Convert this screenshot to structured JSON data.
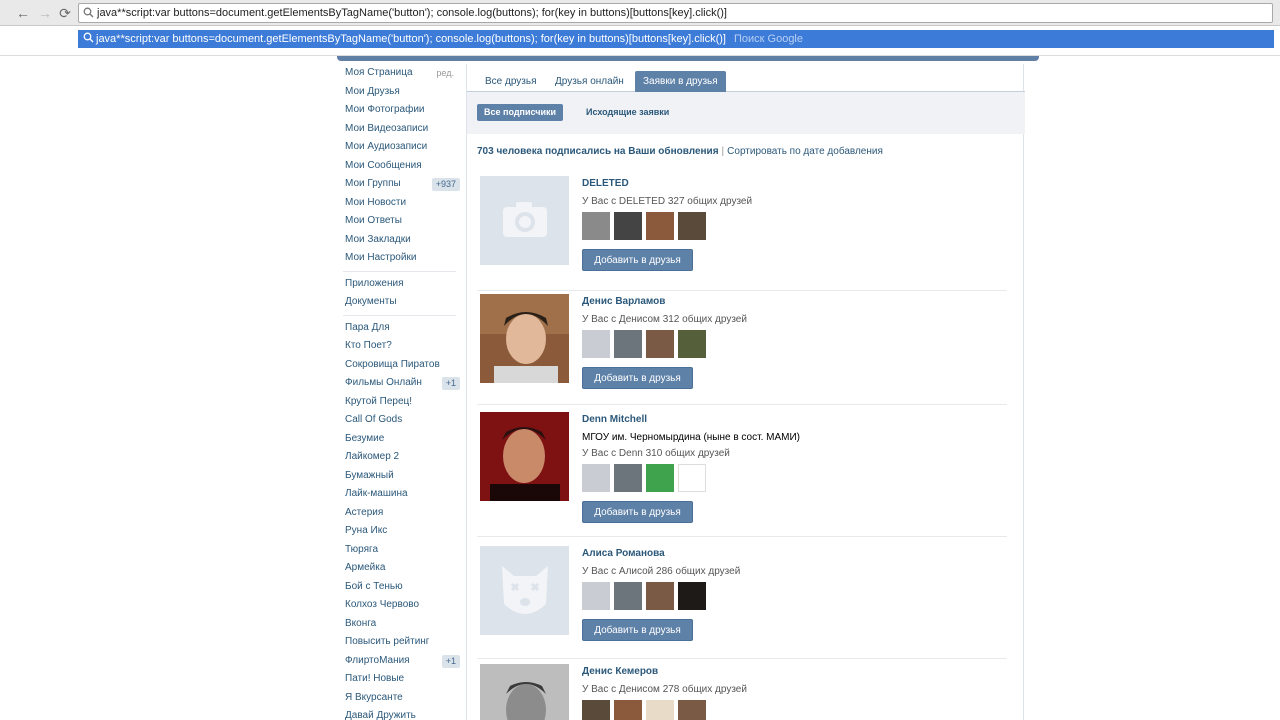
{
  "browser": {
    "address_text": "java**script:var buttons=document.getElementsByTagName('button'); console.log(buttons); for(key in buttons)[buttons[key].click()]",
    "suggestion_text": "java**script:var buttons=document.getElementsByTagName('button'); console.log(buttons); for(key in buttons)[buttons[key].click()]",
    "suggestion_hint": "Поиск Google",
    "icons": {
      "back": "←",
      "forward": "→",
      "reload": "⟳",
      "search": "🔍"
    }
  },
  "sidebar": {
    "edit_label": "ред.",
    "items": [
      {
        "label": "Моя Страница"
      },
      {
        "label": "Мои Друзья"
      },
      {
        "label": "Мои Фотографии"
      },
      {
        "label": "Мои Видеозаписи"
      },
      {
        "label": "Мои Аудиозаписи"
      },
      {
        "label": "Мои Сообщения"
      },
      {
        "label": "Мои Группы",
        "badge": "+937"
      },
      {
        "label": "Мои Новости"
      },
      {
        "label": "Мои Ответы"
      },
      {
        "label": "Мои Закладки"
      },
      {
        "label": "Мои Настройки"
      }
    ],
    "apps_section": [
      {
        "label": "Приложения"
      },
      {
        "label": "Документы"
      }
    ],
    "games": [
      {
        "label": "Пара Для"
      },
      {
        "label": "Кто Поет?"
      },
      {
        "label": "Сокровища Пиратов"
      },
      {
        "label": "Фильмы Онлайн",
        "badge": "+1"
      },
      {
        "label": "Крутой Перец!"
      },
      {
        "label": "Call Of Gods"
      },
      {
        "label": "Безумие"
      },
      {
        "label": "Лайкомер 2"
      },
      {
        "label": "Бумажный"
      },
      {
        "label": "Лайк-машина"
      },
      {
        "label": "Астерия"
      },
      {
        "label": "Руна Икс"
      },
      {
        "label": "Тюряга"
      },
      {
        "label": "Армейка"
      },
      {
        "label": "Бой с Тенью"
      },
      {
        "label": "Колхоз Червово"
      },
      {
        "label": "Вконга"
      },
      {
        "label": "Повысить рейтинг"
      },
      {
        "label": "ФлиртоМания",
        "badge": "+1"
      },
      {
        "label": "Пати! Новые"
      },
      {
        "label": "Я Вкурсанте"
      },
      {
        "label": "Давай Дружить"
      }
    ]
  },
  "tabs": [
    {
      "label": "Все друзья"
    },
    {
      "label": "Друзья онлайн"
    },
    {
      "label": "Заявки в друзья",
      "active": true
    }
  ],
  "subtabs": [
    {
      "label": "Все подписчики",
      "active": true
    },
    {
      "label": "Исходящие заявки"
    }
  ],
  "summary": {
    "count_text": "703 человека подписались на Ваши обновления",
    "separator": "|",
    "sort_text": "Сортировать по дате добавления"
  },
  "add_button_label": "Добавить в друзья",
  "people": [
    {
      "name": "DELETED",
      "mutual": "У Вас с DELETED 327 общих друзей",
      "avatar": "camera-placeholder"
    },
    {
      "name": "Денис Варламов",
      "mutual": "У Вас с Денисом 312 общих друзей",
      "avatar": "photo"
    },
    {
      "name": "Denn Mitchell",
      "education": "МГОУ им. Черномырдина (ныне в сост. МАМИ)",
      "mutual": "У Вас с Denn 310 общих друзей",
      "avatar": "photo"
    },
    {
      "name": "Алиса Романова",
      "mutual": "У Вас с Алисой 286 общих друзей",
      "avatar": "dog-placeholder"
    },
    {
      "name": "Денис Кемеров",
      "mutual": "У Вас с Денисом 278 общих друзей",
      "avatar": "photo"
    }
  ],
  "colors": {
    "accent": "#5e81a8",
    "link": "#2b587a",
    "chrome_highlight": "#3d7bd8"
  }
}
